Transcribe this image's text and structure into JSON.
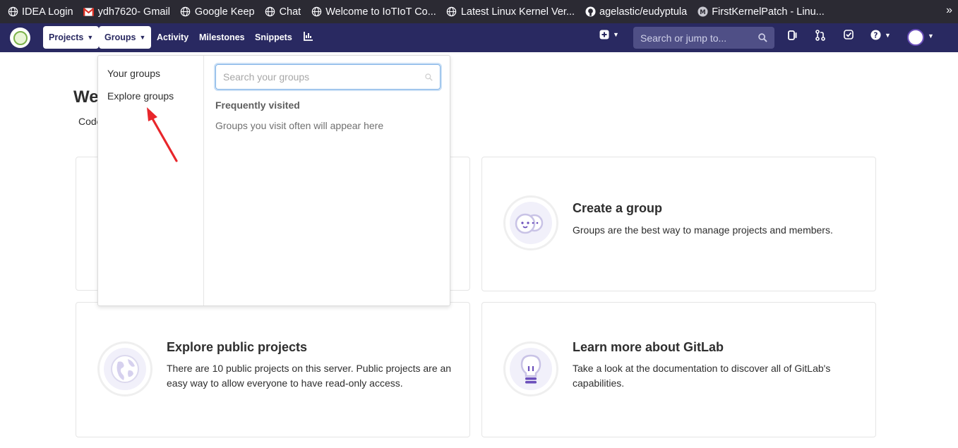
{
  "bookmarks": [
    {
      "label": "IDEA Login",
      "icon": "globe-icon"
    },
    {
      "label": "ydh7620- Gmail",
      "icon": "gmail-icon"
    },
    {
      "label": "Google Keep",
      "icon": "globe-icon"
    },
    {
      "label": "Chat",
      "icon": "globe-icon"
    },
    {
      "label": "Welcome to IoTIoT Co...",
      "icon": "globe-icon"
    },
    {
      "label": "Latest Linux Kernel Ver...",
      "icon": "globe-icon"
    },
    {
      "label": "agelastic/eudyptula",
      "icon": "github-icon"
    },
    {
      "label": "FirstKernelPatch - Linu...",
      "icon": "mediawiki-icon"
    }
  ],
  "navbar": {
    "projects_label": "Projects",
    "groups_label": "Groups",
    "activity_label": "Activity",
    "milestones_label": "Milestones",
    "snippets_label": "Snippets",
    "search_placeholder": "Search or jump to..."
  },
  "main": {
    "welcome_text": "We",
    "subline_text": "Code"
  },
  "cards": [
    {
      "title": "Create a group",
      "text": "Groups are the best way to manage projects and members.",
      "icon": "group-faces-icon"
    },
    {
      "title": "Explore public projects",
      "text": "There are 10 public projects on this server. Public projects are an easy way to allow everyone to have read-only access.",
      "icon": "globe-icon"
    },
    {
      "title": "Learn more about GitLab",
      "text": "Take a look at the documentation to discover all of GitLab's capabilities.",
      "icon": "lightbulb-icon"
    }
  ],
  "dropdown": {
    "your_groups": "Your groups",
    "explore_groups": "Explore groups",
    "search_placeholder": "Search your groups",
    "frequent_heading": "Frequently visited",
    "empty_text": "Groups you visit often will appear here"
  },
  "colors": {
    "navbar": "#292961",
    "accent": "#6b4fbb",
    "annotation_arrow": "#e8262b"
  }
}
